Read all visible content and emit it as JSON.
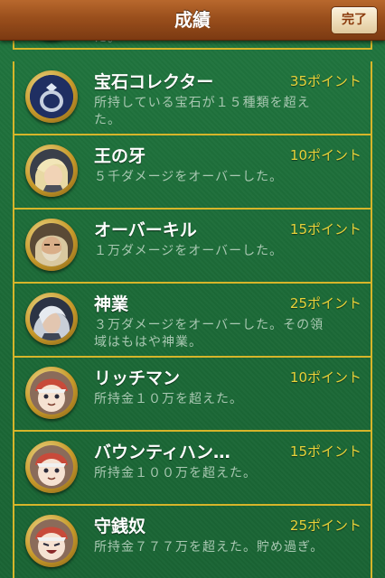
{
  "navbar": {
    "title": "成績",
    "done_label": "完了"
  },
  "colors": {
    "felt": "#1c6a37",
    "gold": "#d6b52a",
    "points": "#e8d23a",
    "nav": "#9a4f1c"
  },
  "partial_row": {
    "desc": "た。"
  },
  "achievements": [
    {
      "title": "宝石コレクター",
      "points": "35ポイント",
      "desc_lines": [
        "所持している宝石が１５種類を超え",
        "た。"
      ],
      "icon": "ring-icon"
    },
    {
      "title": "王の牙",
      "points": "10ポイント",
      "desc_lines": [
        "５千ダメージをオーバーした。"
      ],
      "icon": "blonde-warrior-portrait"
    },
    {
      "title": "オーバーキル",
      "points": "15ポイント",
      "desc_lines": [
        "１万ダメージをオーバーした。"
      ],
      "icon": "bearded-warrior-portrait"
    },
    {
      "title": "神業",
      "points": "25ポイント",
      "desc_lines": [
        "３万ダメージをオーバーした。その領",
        "域はもはや神業。"
      ],
      "icon": "silver-haired-portrait"
    },
    {
      "title": "リッチマン",
      "points": "10ポイント",
      "desc_lines": [
        "所持金１０万を超えた。"
      ],
      "icon": "chibi-character-portrait"
    },
    {
      "title": "バウンティハン…",
      "points": "15ポイント",
      "desc_lines": [
        "所持金１００万を超えた。"
      ],
      "icon": "chibi-character-portrait"
    },
    {
      "title": "守銭奴",
      "points": "25ポイント",
      "desc_lines": [
        "所持金７７７万を超えた。貯め過ぎ。"
      ],
      "icon": "chibi-laughing-portrait"
    }
  ]
}
